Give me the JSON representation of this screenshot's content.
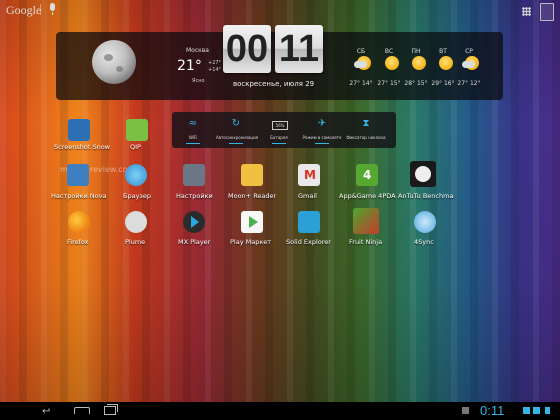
{
  "top_bar": {
    "search_label": "Google"
  },
  "clock": {
    "hours": "00",
    "minutes": "11",
    "date": "воскресенье, июля 29"
  },
  "weather": {
    "city": "Москва",
    "temp": "21°",
    "high": "+27°",
    "low": "+14°",
    "condition": "Ясно"
  },
  "forecast": [
    {
      "day": "СБ",
      "temps": "27° 14°",
      "icon": "cloud-sun-icon"
    },
    {
      "day": "ВС",
      "temps": "27° 15°",
      "icon": "sun-icon"
    },
    {
      "day": "ПН",
      "temps": "28° 15°",
      "icon": "sun-icon"
    },
    {
      "day": "ВТ",
      "temps": "29° 16°",
      "icon": "sun-icon"
    },
    {
      "day": "СР",
      "temps": "27° 12°",
      "icon": "cloud-sun-icon"
    }
  ],
  "toggles": [
    {
      "label": "WiFi",
      "icon": "wifi-icon"
    },
    {
      "label": "Автосинхронизация",
      "icon": "sync-icon"
    },
    {
      "label": "Батарея",
      "icon": "battery-icon",
      "value": "56%"
    },
    {
      "label": "Режим в самолете",
      "icon": "airplane-icon"
    },
    {
      "label": "Фиксатор наклона",
      "icon": "rotation-lock-icon"
    }
  ],
  "apps": [
    {
      "label": "Screenshot Snow",
      "icon": "screenshot-icon",
      "color": "#2d6fb5"
    },
    {
      "label": "QIP",
      "icon": "qip-icon",
      "color": "#7ac143"
    },
    {
      "label": "Настройки Nova",
      "icon": "nova-settings-icon",
      "color": "#3e7fc1"
    },
    {
      "label": "Браузер",
      "icon": "browser-icon",
      "color": "#4aa3df"
    },
    {
      "label": "Настройки",
      "icon": "settings-icon",
      "color": "#6b7784"
    },
    {
      "label": "Moon+ Reader",
      "icon": "book-icon",
      "color": "#f0c040"
    },
    {
      "label": "Gmail",
      "icon": "gmail-icon",
      "color": "#e8e8e8"
    },
    {
      "label": "App&Game 4PDA",
      "icon": "4pda-icon",
      "color": "#56a830"
    },
    {
      "label": "AnTuTu Benchma",
      "icon": "antutu-icon",
      "color": "#1a1a1a"
    },
    {
      "label": "Firefox",
      "icon": "firefox-icon",
      "color": "#e66000"
    },
    {
      "label": "Plume",
      "icon": "plume-icon",
      "color": "#dcdcdc"
    },
    {
      "label": "MX Player",
      "icon": "mx-player-icon",
      "color": "#2b2b2b"
    },
    {
      "label": "Play Маркет",
      "icon": "play-market-icon",
      "color": "#9dc13c"
    },
    {
      "label": "Solid Explorer",
      "icon": "folder-icon",
      "color": "#2aa0d4"
    },
    {
      "label": "Fruit Ninja",
      "icon": "fruit-ninja-icon",
      "color": "#c83a2a"
    },
    {
      "label": "4Sync",
      "icon": "4sync-icon",
      "color": "#4aa7e0"
    }
  ],
  "status": {
    "time": "0:11"
  },
  "watermark": "mobile-review.com"
}
